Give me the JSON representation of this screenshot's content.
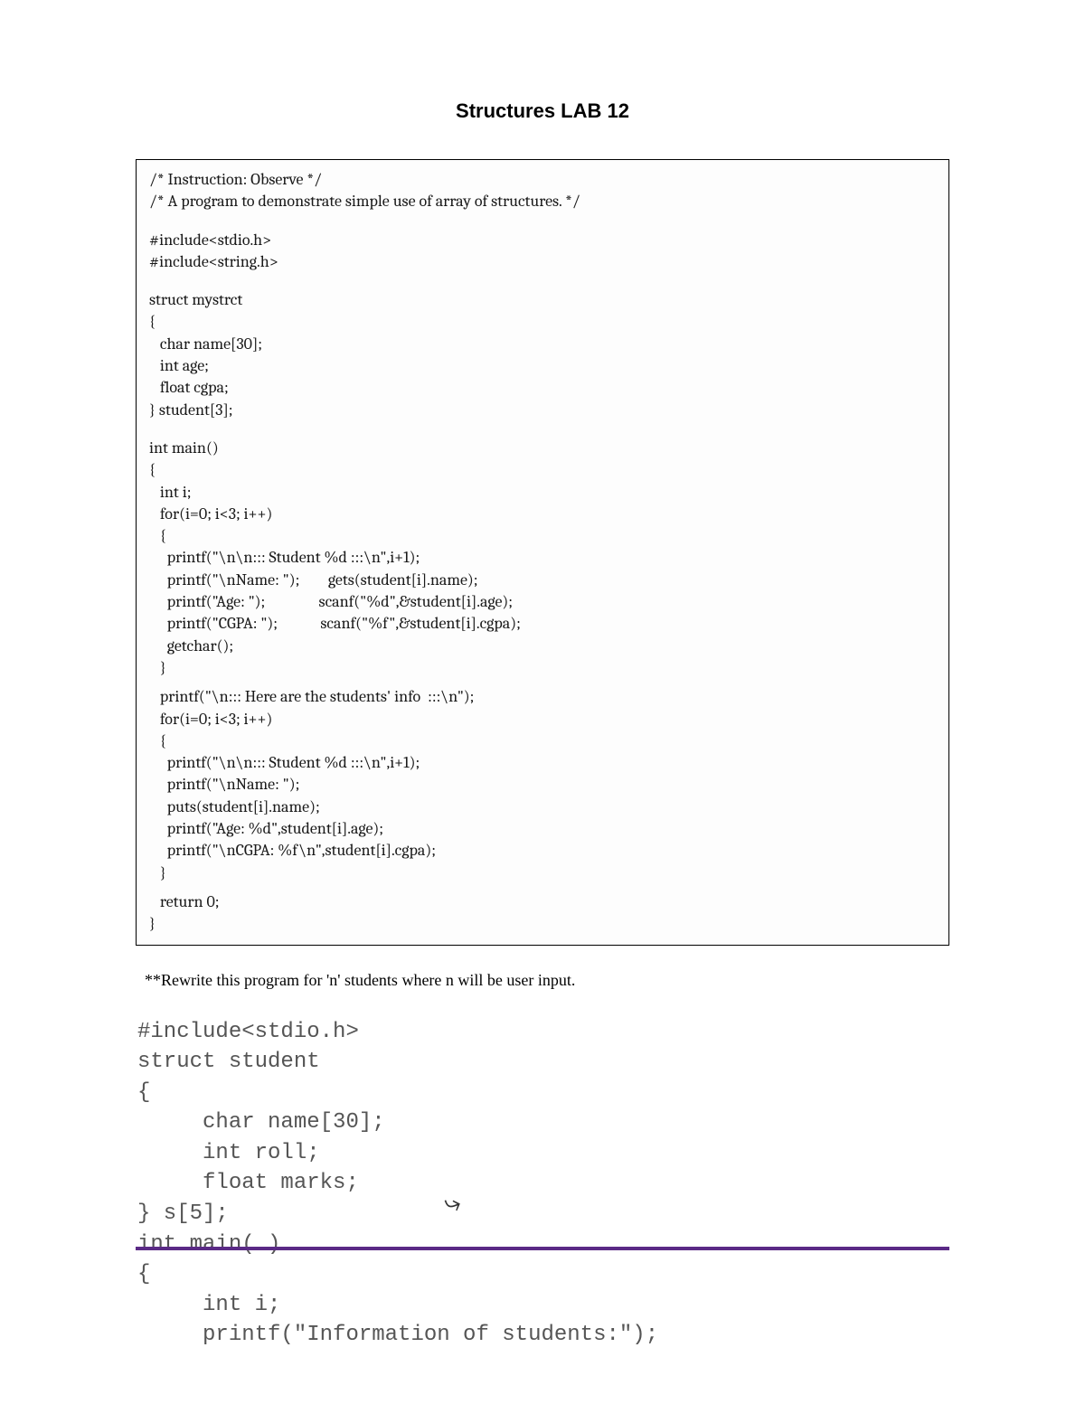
{
  "title": "Structures LAB 12",
  "code1": {
    "l01": "/* Instruction: Observe */",
    "l02": "/* A program to demonstrate simple use of array of structures. */",
    "l03": "#include<stdio.h>",
    "l04": "#include<string.h>",
    "l05": "struct mystrct",
    "l06": "{",
    "l07": "   char name[30];",
    "l08": "   int age;",
    "l09": "   float cgpa;",
    "l10": "} student[3];",
    "l11": "int main()",
    "l12": "{",
    "l13": "   int i;",
    "l14": "   for(i=0; i<3; i++)",
    "l15": "   {",
    "l16": "     printf(\"\\n\\n::: Student %d :::\\n\",i+1);",
    "l17": "     printf(\"\\nName: \");        gets(student[i].name);",
    "l18": "     printf(\"Age: \");               scanf(\"%d\",&student[i].age);",
    "l19": "     printf(\"CGPA: \");            scanf(\"%f\",&student[i].cgpa);",
    "l20": "     getchar();",
    "l21": "   }",
    "l22": "   printf(\"\\n::: Here are the students' info  :::\\n\");",
    "l23": "   for(i=0; i<3; i++)",
    "l24": "   {",
    "l25": "     printf(\"\\n\\n::: Student %d :::\\n\",i+1);",
    "l26": "     printf(\"\\nName: \");",
    "l27": "     puts(student[i].name);",
    "l28": "     printf(\"Age: %d\",student[i].age);",
    "l29": "     printf(\"\\nCGPA: %f\\n\",student[i].cgpa);",
    "l30": "   }",
    "l31": "   return 0;",
    "l32": "}"
  },
  "rewrite_note": "**Rewrite this program for 'n' students where n will be user input.",
  "code2": {
    "l01": "#include<stdio.h>",
    "l02": "struct student",
    "l03": "{",
    "l04": "     char name[30];",
    "l05": "     int roll;",
    "l06": "     float marks;",
    "l07": "} s[5];",
    "l08": "int main( )",
    "l09": "{",
    "l10": "     int i;",
    "l11": "     printf(\"Information of students:\");"
  }
}
